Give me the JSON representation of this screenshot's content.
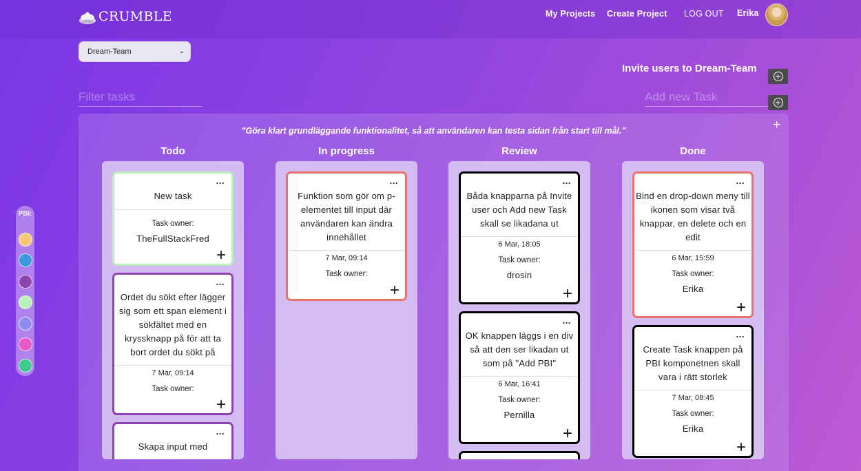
{
  "header": {
    "logo_text": "CRUMBLE",
    "nav": {
      "my_projects": "My Projects",
      "create_project": "Create Project",
      "logout": "LOG OUT",
      "user_name": "Erika"
    }
  },
  "controls": {
    "team_selected": "Dream-Team",
    "invite_label": "Invite users to Dream-Team",
    "filter_placeholder": "Filter tasks",
    "new_task_placeholder": "Add new Task"
  },
  "board": {
    "goal": "\"Göra klart grundläggande funktionalitet, så att användaren kan testa sidan från start till mål.\"",
    "add_symbol": "+",
    "columns": [
      {
        "title": "Todo",
        "cards": [
          {
            "title": "New task",
            "date": "",
            "owner_label": "Task owner:",
            "owner": "TheFullStackFred",
            "border": "#b8f0b8"
          },
          {
            "title": "Ordet du sökt efter lägger sig som ett span element i sökfältet med en kryssknapp på för att ta bort ordet du sökt på",
            "date": "7 Mar, 09:14",
            "owner_label": "Task owner:",
            "owner": "",
            "border": "#8e44ad"
          },
          {
            "title": "Skapa input med",
            "date": "",
            "owner_label": "",
            "owner": "",
            "border": "#8e44ad"
          }
        ]
      },
      {
        "title": "In progress",
        "cards": [
          {
            "title": "Funktion som gör om p-elementet till input där användaren kan ändra innehållet",
            "date": "7 Mar, 09:14",
            "owner_label": "Task owner:",
            "owner": "",
            "border": "#e8736a"
          }
        ]
      },
      {
        "title": "Review",
        "cards": [
          {
            "title": "Båda knapparna på Invite user och Add new Task skall se likadana ut",
            "date": "6 Mar, 18:05",
            "owner_label": "Task owner:",
            "owner": "drosin",
            "border": "#000000"
          },
          {
            "title": "OK knappen läggs i en div så att den ser likadan ut som på \"Add PBI\"",
            "date": "6 Mar, 16:41",
            "owner_label": "Task owner:",
            "owner": "Pernilla",
            "border": "#000000"
          }
        ]
      },
      {
        "title": "Done",
        "cards": [
          {
            "title": "Bind en drop-down meny till ikonen som visar två knappar, en delete och en edit",
            "date": "6 Mar, 15:59",
            "owner_label": "Task owner:",
            "owner": "Erika",
            "border": "#e8736a"
          },
          {
            "title": "Create Task knappen på PBI komponetnen skall vara i rätt storlek",
            "date": "7 Mar, 08:45",
            "owner_label": "Task owner:",
            "owner": "Erika",
            "border": "#000000"
          }
        ]
      }
    ]
  },
  "pbi": {
    "label": "PBI:",
    "colors": [
      "#f8c879",
      "#3a9ad9",
      "#8e44ad",
      "#b8f0b8",
      "#8f8cf0",
      "#e85ac9",
      "#3fc98a"
    ]
  },
  "icons": {
    "card_menu": "...",
    "card_add": "+",
    "plus_circle": "+",
    "select_chevron": "⌄"
  }
}
